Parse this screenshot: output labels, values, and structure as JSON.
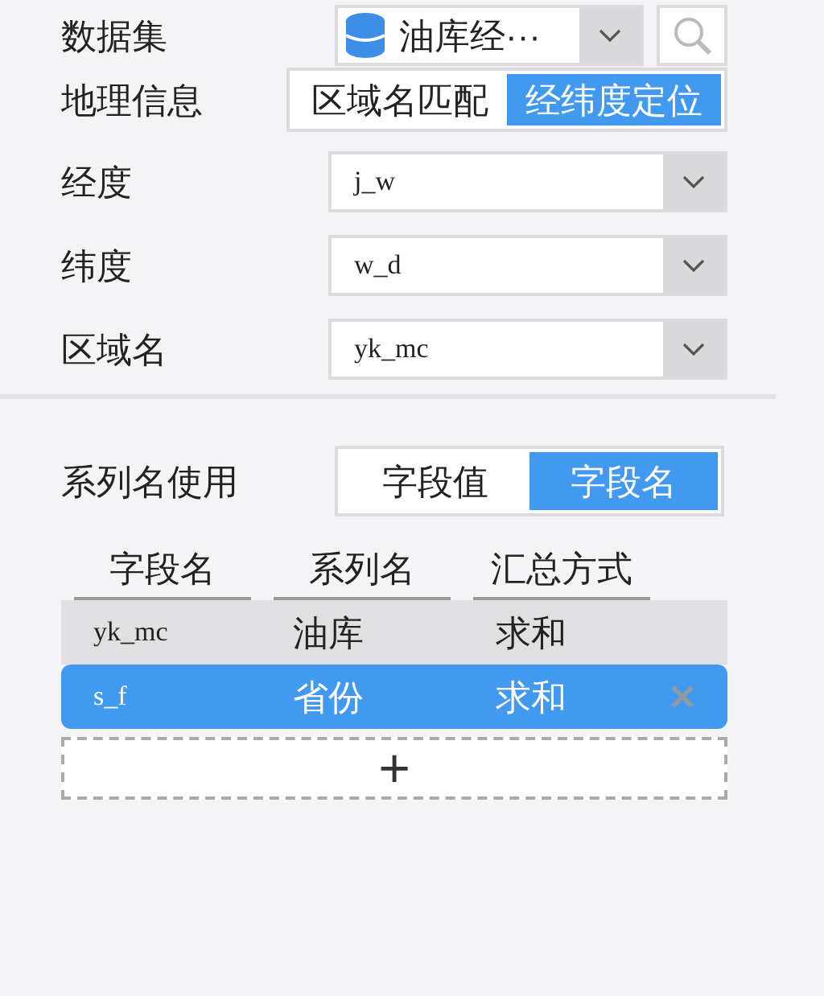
{
  "dataset": {
    "label": "数据集",
    "value": "油库经···"
  },
  "geo": {
    "label": "地理信息",
    "options": [
      {
        "label": "区域名匹配",
        "selected": false
      },
      {
        "label": "经纬度定位",
        "selected": true
      }
    ]
  },
  "fields": [
    {
      "label": "经度",
      "value": "j_w"
    },
    {
      "label": "纬度",
      "value": "w_d"
    },
    {
      "label": "区域名",
      "value": "yk_mc"
    }
  ],
  "series_name": {
    "label": "系列名使用",
    "options": [
      {
        "label": "字段值",
        "selected": false
      },
      {
        "label": "字段名",
        "selected": true
      }
    ]
  },
  "table": {
    "columns": [
      "字段名",
      "系列名",
      "汇总方式"
    ],
    "rows": [
      {
        "cells": [
          "yk_mc",
          "油库",
          "求和"
        ],
        "selected": false
      },
      {
        "cells": [
          "s_f",
          "省份",
          "求和"
        ],
        "selected": true
      }
    ]
  },
  "add_button": "+"
}
